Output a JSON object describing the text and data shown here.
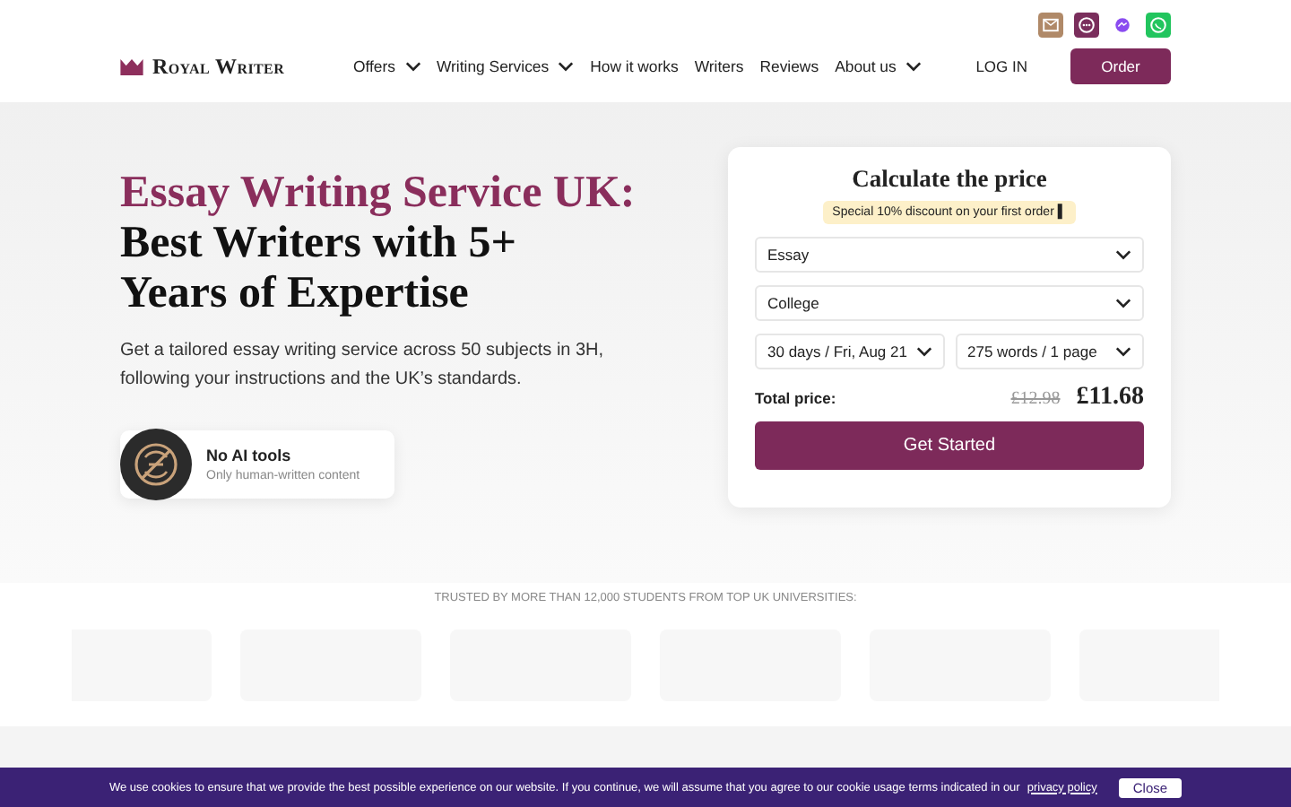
{
  "header": {
    "logo": {
      "first": "Royal",
      "second": "Writer"
    },
    "nav": [
      {
        "label": "Offers",
        "kind": "menu"
      },
      {
        "label": "Writing Services",
        "kind": "menu"
      },
      {
        "label": "How it works",
        "kind": "link"
      },
      {
        "label": "Writers",
        "kind": "link"
      },
      {
        "label": "Reviews",
        "kind": "link"
      },
      {
        "label": "About us",
        "kind": "menu"
      }
    ],
    "login": "LOG IN",
    "order": "Order"
  },
  "hero": {
    "title_accent": "Essay Writing Service UK:",
    "title_rest": "Best Writers with 5+ Years of Expertise",
    "subtitle": "Get a tailored essay writing service across 50 subjects in 3H, following your instructions and the UK’s standards.",
    "badge": {
      "title": "No AI tools",
      "text": "Only human-written content"
    }
  },
  "calculator": {
    "title": "Calculate the price",
    "discount": "Special 10% discount on your first order ▌",
    "selects": [
      {
        "value": "Essay",
        "kind": "full"
      },
      {
        "value": "College",
        "kind": "full"
      },
      {
        "value": "30 days / Fri, Aug 21",
        "kind": "half"
      },
      {
        "value": "275 words / 1 page",
        "kind": "half"
      }
    ],
    "total_label": "Total price:",
    "old_price": "£12.98",
    "price": "£11.68",
    "button": "Get Started"
  },
  "trusted": {
    "caption": "TRUSTED BY MORE THAN 12,000 STUDENTS FROM TOP UK UNIVERSITIES:"
  },
  "cookie": {
    "text": "We use cookies to ensure that we provide the best possible experience on our website. If you continue, we will assume that you agree to our cookie usage terms indicated in our",
    "link": "privacy policy",
    "button": "Close"
  }
}
